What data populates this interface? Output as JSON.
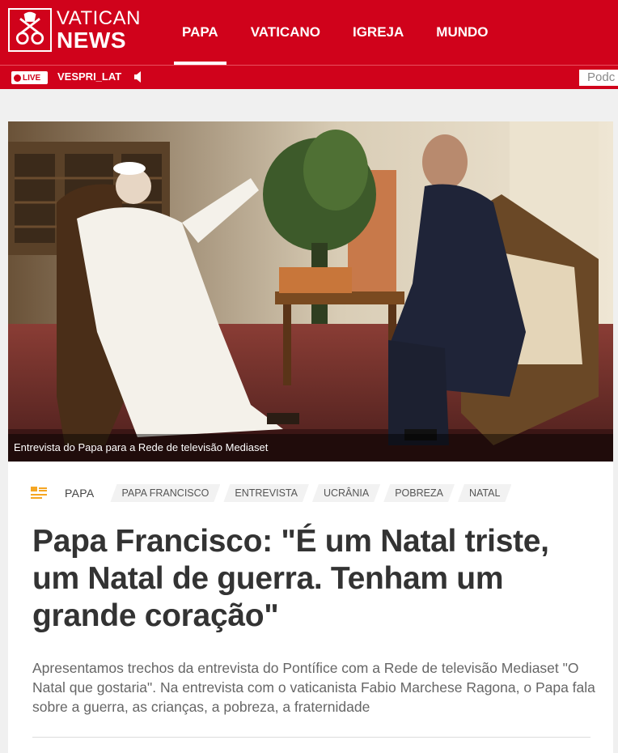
{
  "header": {
    "logo_line1": "VATICAN",
    "logo_line2": "NEWS",
    "nav": [
      {
        "label": "PAPA",
        "active": true
      },
      {
        "label": "VATICANO"
      },
      {
        "label": "IGREJA"
      },
      {
        "label": "MUNDO"
      }
    ],
    "brand_color": "#d0021b"
  },
  "subbar": {
    "live_label": "LIVE",
    "radio_program": "VESPRI_LAT",
    "podcast_partial": "Podc"
  },
  "article": {
    "image_caption": "Entrevista do Papa para a Rede de televisão Mediaset",
    "section": "PAPA",
    "tags": [
      "PAPA FRANCISCO",
      "ENTREVISTA",
      "UCRÂNIA",
      "POBREZA",
      "NATAL"
    ],
    "title": "Papa Francisco: \"É um Natal triste, um Natal de guerra. Tenham um grande coração\"",
    "lead": "Apresentamos trechos da entrevista do Pontífice com a Rede de televisão Mediaset \"O Natal que gostaria\". Na entrevista com o vaticanista Fabio Marchese Ragona, o Papa fala sobre a guerra, as crianças, a pobreza, a fraternidade"
  }
}
